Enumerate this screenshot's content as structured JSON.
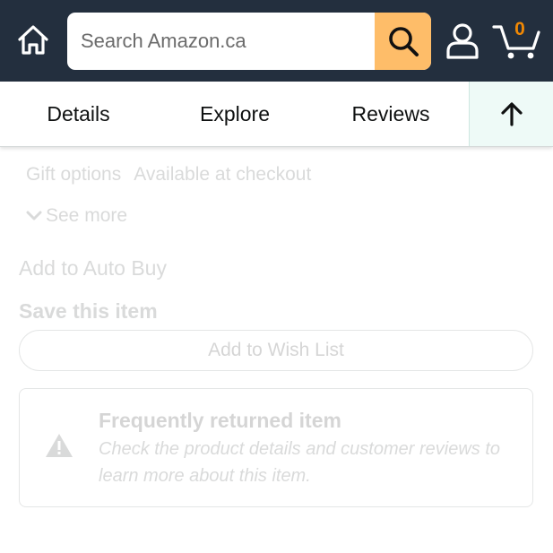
{
  "header": {
    "search": {
      "placeholder": "Search Amazon.ca",
      "value": ""
    },
    "cart": {
      "count": "0"
    },
    "icons": {
      "home": "home-icon",
      "search": "search-icon",
      "account": "user-icon",
      "cart": "cart-icon"
    }
  },
  "tabs": [
    {
      "label": "Details"
    },
    {
      "label": "Explore"
    },
    {
      "label": "Reviews"
    }
  ],
  "back_to_top": {
    "icon": "arrow-up-icon"
  },
  "content": {
    "gift_options_label": "Gift options",
    "gift_options_value": "Available at checkout",
    "see_more": "See more",
    "auto_buy": "Add to Auto Buy",
    "save_title": "Save this item",
    "wishlist_button": "Add to Wish List",
    "returned": {
      "title": "Frequently returned item",
      "text": "Check the product details and customer reviews to learn more about this item."
    }
  },
  "colors": {
    "header_bg": "#232f3e",
    "search_button": "#febd69",
    "cart_count": "#f08804",
    "back_to_top_bg": "#eefaf7",
    "link": "#007185"
  }
}
